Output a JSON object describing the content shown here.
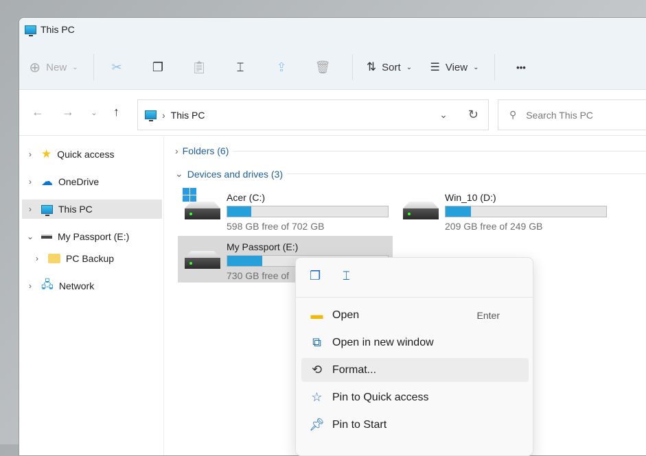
{
  "window": {
    "title": "This PC"
  },
  "toolbar": {
    "new_label": "New",
    "sort_label": "Sort",
    "view_label": "View",
    "more": "•••"
  },
  "address": {
    "path": "This PC",
    "search_placeholder": "Search This PC"
  },
  "sidebar": {
    "items": [
      {
        "label": "Quick access"
      },
      {
        "label": "OneDrive"
      },
      {
        "label": "This PC"
      },
      {
        "label": "My Passport (E:)"
      },
      {
        "label": "PC Backup"
      },
      {
        "label": "Network"
      }
    ]
  },
  "main": {
    "folders_group": "Folders (6)",
    "devices_group": "Devices and drives (3)",
    "drives": [
      {
        "name": "Acer (C:)",
        "free": "598 GB free of 702 GB",
        "used_fraction": 0.15
      },
      {
        "name": "Win_10 (D:)",
        "free": "209 GB free of 249 GB",
        "used_fraction": 0.16
      },
      {
        "name": "My Passport (E:)",
        "free": "730 GB free of",
        "used_fraction": 0.22
      }
    ]
  },
  "context_menu": {
    "items": [
      {
        "label": "Open",
        "shortcut": "Enter"
      },
      {
        "label": "Open in new window"
      },
      {
        "label": "Format..."
      },
      {
        "label": "Pin to Quick access"
      },
      {
        "label": "Pin to Start"
      }
    ]
  },
  "colors": {
    "accent": "#26a0da",
    "link": "#1d5e9d"
  }
}
